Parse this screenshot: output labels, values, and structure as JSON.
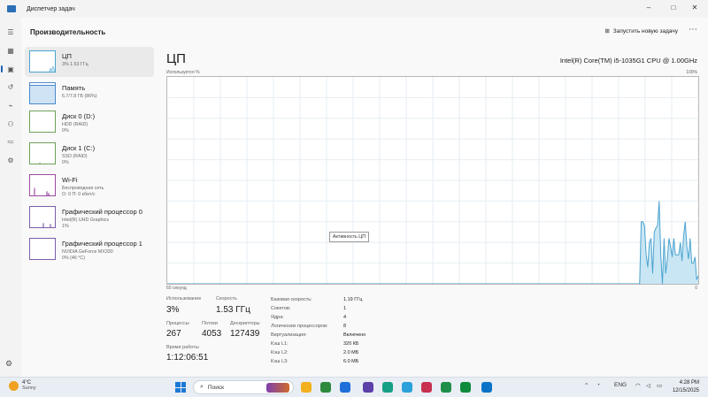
{
  "window": {
    "title": "Диспетчер задач",
    "controls": [
      "–",
      "□",
      "✕"
    ]
  },
  "sidebar": {
    "icons": [
      "menu-icon",
      "processes-icon",
      "performance-icon",
      "app-history-icon",
      "startup-icon",
      "users-icon",
      "details-icon",
      "services-icon"
    ],
    "settings_icon": "settings-icon"
  },
  "header": {
    "page_title": "Производительность",
    "run_task": "Запустить новую задачу",
    "more": "⋯"
  },
  "perf_items": [
    {
      "name": "ЦП",
      "sub1": "3%  1.53 ГГц",
      "sub2": ""
    },
    {
      "name": "Память",
      "sub1": "6.7/7.8 ГБ (86%)",
      "sub2": ""
    },
    {
      "name": "Диск 0 (D:)",
      "sub1": "HDD (RAID)",
      "sub2": "0%"
    },
    {
      "name": "Диск 1 (C:)",
      "sub1": "SSD (RAID)",
      "sub2": "0%"
    },
    {
      "name": "Wi-Fi",
      "sub1": "Беспроводная сеть",
      "sub2": "О: 0 П: 0 кбит/с"
    },
    {
      "name": "Графический процессор 0",
      "sub1": "Intel(R) UHD Graphics",
      "sub2": "1%"
    },
    {
      "name": "Графический процессор 1",
      "sub1": "NVIDIA GeForce MX330",
      "sub2": "0%  (46 °C)"
    }
  ],
  "cpu": {
    "title": "ЦП",
    "model": "Intel(R) Core(TM) i5-1035G1 CPU @ 1.00GHz",
    "graph_top_left": "Используется %",
    "graph_top_right": "100%",
    "graph_bottom_left": "60 секунд",
    "graph_bottom_right": "0",
    "tooltip": "Активность ЦП",
    "usage_history": [
      0,
      0,
      0,
      0,
      0,
      0,
      0,
      0,
      0,
      0,
      0,
      0,
      0,
      0,
      0,
      0,
      0,
      0,
      0,
      0,
      0,
      0,
      0,
      0,
      0,
      0,
      0,
      0,
      0,
      0,
      0,
      0,
      0,
      0,
      0,
      0,
      0,
      0,
      0,
      0,
      0,
      0,
      0,
      0,
      0,
      0,
      0,
      0,
      0,
      0,
      0,
      0,
      0,
      0,
      0,
      0,
      0,
      0,
      0,
      0,
      0,
      0,
      0,
      0,
      0,
      0,
      0,
      0,
      0,
      0,
      0,
      0,
      0,
      0,
      0,
      0,
      0,
      0,
      0,
      0,
      0,
      0,
      0,
      0,
      0,
      0,
      0,
      0,
      0,
      0,
      0,
      0,
      0,
      0,
      0,
      0,
      0,
      0,
      0,
      0,
      0,
      0,
      0,
      0,
      0,
      0,
      0,
      0,
      0,
      0,
      0,
      0,
      0,
      0,
      0,
      0,
      0,
      0,
      0,
      0,
      0,
      0,
      0,
      0,
      0,
      0,
      0,
      0,
      0,
      0,
      0,
      0,
      0,
      0,
      0,
      0,
      0,
      0,
      0,
      0,
      0,
      0,
      0,
      0,
      0,
      0,
      0,
      0,
      0,
      0,
      0,
      0,
      0,
      0,
      0,
      0,
      0,
      0,
      0,
      0,
      0,
      0,
      0,
      0,
      0,
      0,
      0,
      0,
      0,
      0,
      0,
      0,
      0,
      0,
      0,
      0,
      0,
      0,
      0,
      0,
      0,
      0,
      0,
      0,
      0,
      0,
      0,
      0,
      0,
      0,
      0,
      0,
      0,
      0,
      0,
      0,
      0,
      0,
      0,
      0,
      0,
      0,
      0,
      0,
      0,
      0,
      0,
      0,
      0,
      0,
      0,
      0,
      0,
      0,
      0,
      0,
      0,
      0,
      0,
      0,
      0,
      0,
      0,
      0,
      0,
      0,
      0,
      0,
      0,
      0,
      0,
      0,
      0,
      0,
      0,
      0,
      0,
      0,
      0,
      0,
      0,
      0,
      0,
      0,
      0,
      0,
      0,
      0,
      0,
      0,
      0,
      0,
      0,
      0,
      0,
      0,
      0,
      0,
      0,
      0,
      0,
      0,
      0,
      0,
      0,
      0,
      0,
      0,
      0,
      0,
      0,
      0,
      0,
      0,
      0,
      0,
      0,
      0,
      0,
      0,
      0,
      0,
      0,
      0,
      0,
      0,
      0,
      0,
      0,
      0,
      0,
      30,
      30,
      28,
      14,
      8,
      20,
      22,
      5,
      25,
      27,
      28,
      40,
      14,
      0,
      22,
      5,
      12,
      22,
      18,
      13,
      22,
      14,
      14,
      14,
      20,
      11,
      23,
      30,
      18,
      12,
      22,
      10,
      10,
      13,
      2,
      4
    ],
    "usage_history_note": ""
  },
  "stats": {
    "utilization_label": "Использование",
    "utilization": "3%",
    "speed_label": "Скорость",
    "speed": "1.53 ГГц",
    "processes_label": "Процессы",
    "processes": "267",
    "threads_label": "Потоки",
    "threads": "4053",
    "handles_label": "Дескрипторы",
    "handles": "127439",
    "uptime_label": "Время работы",
    "uptime": "1:12:06:51"
  },
  "specs": [
    {
      "label": "Базовая скорость:",
      "value": "1.19 ГГц"
    },
    {
      "label": "Сокетов:",
      "value": "1"
    },
    {
      "label": "Ядра:",
      "value": "4"
    },
    {
      "label": "Логических процессоров:",
      "value": "8"
    },
    {
      "label": "Виртуализация:",
      "value": "Включено"
    },
    {
      "label": "Кэш L1:",
      "value": "320 КБ"
    },
    {
      "label": "Кэш L2:",
      "value": "2.0 МБ"
    },
    {
      "label": "Кэш L3:",
      "value": "6.0 МБ"
    }
  ],
  "taskbar": {
    "weather_temp": "4°C",
    "weather_desc": "Sunny",
    "search_placeholder": "Поиск",
    "lang": "ENG",
    "time": "4:28 PM",
    "date": "12/15/2025",
    "app_colors": [
      "#f2b01e",
      "#2d8a3e",
      "#1e6fd9",
      "#5c3fa8",
      "#16a085",
      "#2aa1da",
      "#c7304f",
      "#1d8f4a",
      "#0e8a3c",
      "#0b73c7"
    ]
  },
  "colors": {
    "accent": "#1b62b7",
    "cpu_fill": "#c9e6f4",
    "cpu_line": "#4aa3cf",
    "mem_fill": "#cfe3f5",
    "wifi_line": "#9c4aa0",
    "gpu_line": "#7b5ea7"
  }
}
